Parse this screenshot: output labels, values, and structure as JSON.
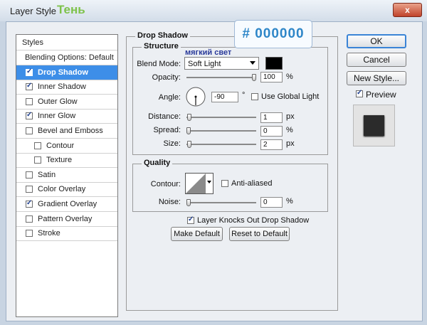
{
  "window": {
    "title": "Layer Style",
    "title_accent": "Тень",
    "close_label": "x"
  },
  "callout": {
    "color_value": "# 000000",
    "tooltip": "мягкий свет"
  },
  "style_list": {
    "header": "Styles",
    "items": [
      {
        "label": "Blending Options: Default",
        "checkbox": false,
        "checked": false,
        "selected": false,
        "indent": false
      },
      {
        "label": "Drop Shadow",
        "checkbox": true,
        "checked": true,
        "selected": true,
        "indent": false
      },
      {
        "label": "Inner Shadow",
        "checkbox": true,
        "checked": true,
        "selected": false,
        "indent": false
      },
      {
        "label": "Outer Glow",
        "checkbox": true,
        "checked": false,
        "selected": false,
        "indent": false
      },
      {
        "label": "Inner Glow",
        "checkbox": true,
        "checked": true,
        "selected": false,
        "indent": false
      },
      {
        "label": "Bevel and Emboss",
        "checkbox": true,
        "checked": false,
        "selected": false,
        "indent": false
      },
      {
        "label": "Contour",
        "checkbox": true,
        "checked": false,
        "selected": false,
        "indent": true
      },
      {
        "label": "Texture",
        "checkbox": true,
        "checked": false,
        "selected": false,
        "indent": true
      },
      {
        "label": "Satin",
        "checkbox": true,
        "checked": false,
        "selected": false,
        "indent": false
      },
      {
        "label": "Color Overlay",
        "checkbox": true,
        "checked": false,
        "selected": false,
        "indent": false
      },
      {
        "label": "Gradient Overlay",
        "checkbox": true,
        "checked": true,
        "selected": false,
        "indent": false
      },
      {
        "label": "Pattern Overlay",
        "checkbox": true,
        "checked": false,
        "selected": false,
        "indent": false
      },
      {
        "label": "Stroke",
        "checkbox": true,
        "checked": false,
        "selected": false,
        "indent": false
      }
    ]
  },
  "drop_shadow": {
    "section_title": "Drop Shadow",
    "structure": {
      "title": "Structure",
      "blend_mode_label": "Blend Mode:",
      "blend_mode_value": "Soft Light",
      "shadow_color": "#000000",
      "opacity_label": "Opacity:",
      "opacity_value": "100",
      "opacity_unit": "%",
      "opacity_fraction": 1.0,
      "angle_label": "Angle:",
      "angle_value": "-90",
      "angle_unit": "°",
      "use_global_light_label": "Use Global Light",
      "use_global_light_checked": false,
      "distance_label": "Distance:",
      "distance_value": "1",
      "distance_unit": "px",
      "distance_fraction": 0.01,
      "spread_label": "Spread:",
      "spread_value": "0",
      "spread_unit": "%",
      "spread_fraction": 0.0,
      "size_label": "Size:",
      "size_value": "2",
      "size_unit": "px",
      "size_fraction": 0.01
    },
    "quality": {
      "title": "Quality",
      "contour_label": "Contour:",
      "anti_aliased_label": "Anti-aliased",
      "anti_aliased_checked": false,
      "noise_label": "Noise:",
      "noise_value": "0",
      "noise_unit": "%",
      "noise_fraction": 0.0
    },
    "knocks_out_label": "Layer Knocks Out Drop Shadow",
    "knocks_out_checked": true,
    "make_default_label": "Make Default",
    "reset_default_label": "Reset to Default"
  },
  "actions": {
    "ok_label": "OK",
    "cancel_label": "Cancel",
    "new_style_label": "New Style...",
    "preview_label": "Preview",
    "preview_checked": true
  },
  "icons": [
    "close-icon",
    "chevron-down-icon",
    "checkmark-icon",
    "angle-dial-icon",
    "contour-curve-icon",
    "color-swatch-icon"
  ]
}
